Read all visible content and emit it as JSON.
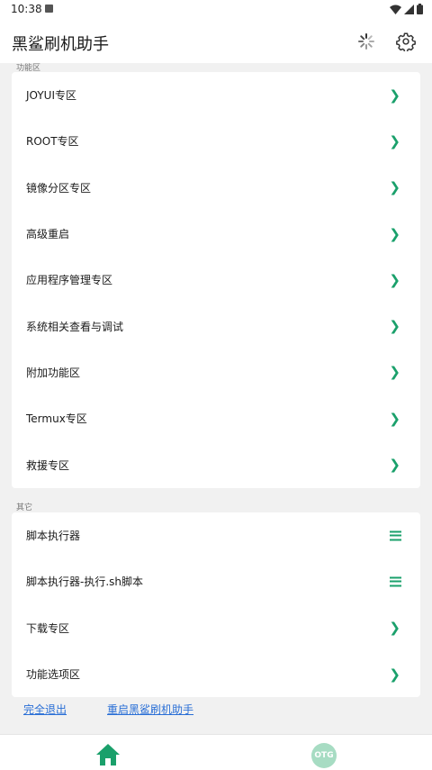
{
  "status_bar": {
    "time": "10:38"
  },
  "app_bar": {
    "title": "黑鲨刷机助手"
  },
  "sections": [
    {
      "label": "功能区",
      "items": [
        {
          "label": "JOYUI专区",
          "icon": "chevron-right-icon"
        },
        {
          "label": "ROOT专区",
          "icon": "chevron-right-icon"
        },
        {
          "label": "镜像分区专区",
          "icon": "chevron-right-icon"
        },
        {
          "label": "高级重启",
          "icon": "chevron-right-icon"
        },
        {
          "label": "应用程序管理专区",
          "icon": "chevron-right-icon"
        },
        {
          "label": "系统相关查看与调试",
          "icon": "chevron-right-icon"
        },
        {
          "label": "附加功能区",
          "icon": "chevron-right-icon"
        },
        {
          "label": "Termux专区",
          "icon": "chevron-right-icon"
        },
        {
          "label": "救援专区",
          "icon": "chevron-right-icon"
        }
      ]
    },
    {
      "label": "其它",
      "items": [
        {
          "label": "脚本执行器",
          "icon": "menu-icon"
        },
        {
          "label": "脚本执行器-执行.sh脚本",
          "icon": "menu-icon"
        },
        {
          "label": "下载专区",
          "icon": "chevron-right-icon"
        },
        {
          "label": "功能选项区",
          "icon": "chevron-right-icon"
        }
      ]
    }
  ],
  "links": {
    "exit": "完全退出",
    "restart": "重启黑鲨刷机助手"
  },
  "bottom_nav": {
    "otg": "OTG"
  },
  "colors": {
    "accent": "#1aa06b",
    "link": "#2a6fd6",
    "background": "#f1f1f1"
  }
}
